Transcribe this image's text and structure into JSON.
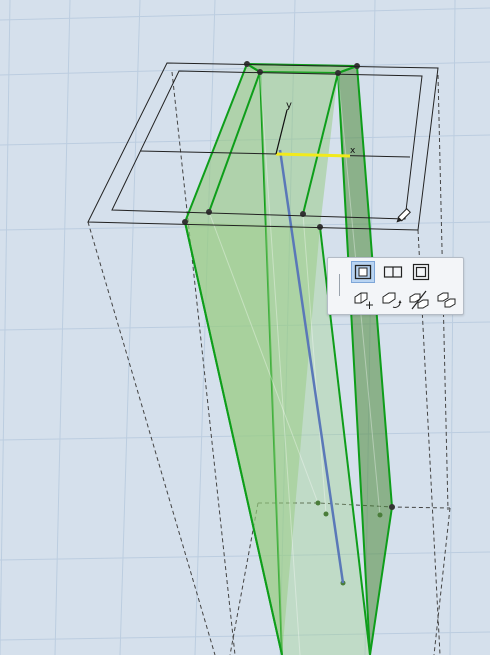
{
  "viewport": {
    "axis_labels": {
      "y": "y",
      "x": "x"
    },
    "colors": {
      "background": "#d5e0ec",
      "grid": "#bccde0",
      "wall_fill": "#8fc776",
      "wall_edge": "#0e9e1a",
      "reference_line": "#5a78b8",
      "x_axis_highlight": "#f2ea1c"
    }
  },
  "pet_palette": {
    "tools": [
      {
        "name": "reference-line-tool",
        "icon": "vertical-line-icon",
        "active": false
      },
      {
        "name": "offset-both-sides",
        "icon": "offset-both-sides-icon",
        "active": true
      },
      {
        "name": "offset-one-side",
        "icon": "offset-one-side-icon",
        "active": false
      },
      {
        "name": "offset-outline",
        "icon": "offset-outline-icon",
        "active": false
      },
      {
        "name": "move",
        "icon": "move-icon",
        "active": false
      },
      {
        "name": "rotate",
        "icon": "rotate-icon",
        "active": false
      },
      {
        "name": "mirror",
        "icon": "mirror-icon",
        "active": false
      },
      {
        "name": "multiply",
        "icon": "multiply-icon",
        "active": false
      }
    ]
  }
}
